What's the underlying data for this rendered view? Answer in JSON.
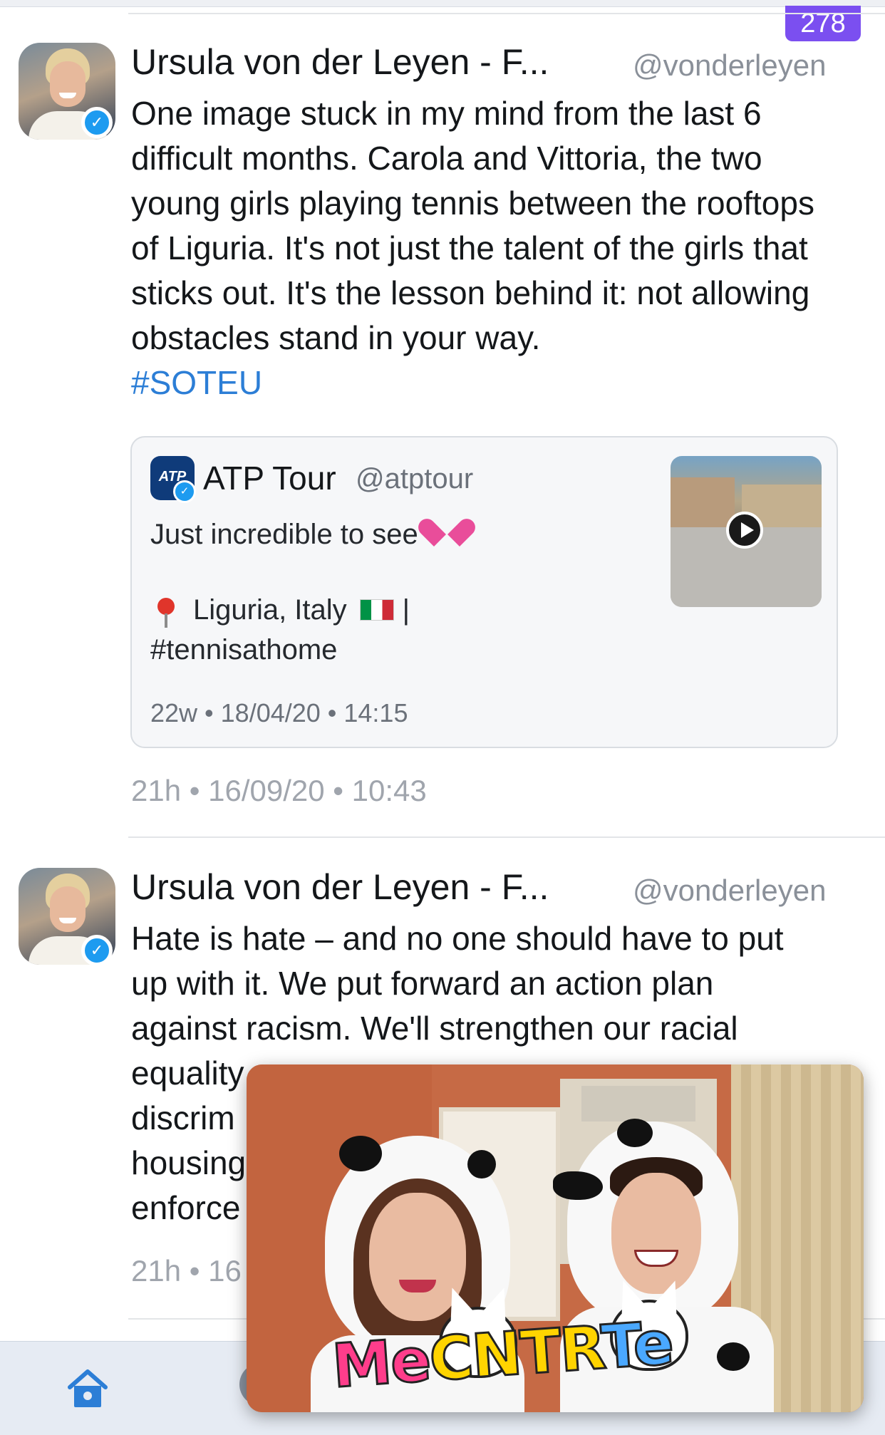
{
  "header": {
    "unread_count": "278"
  },
  "tweets": [
    {
      "author_name": "Ursula von der Leyen - F...",
      "handle": "@vonderleyen",
      "text": "One image stuck in my mind from the last 6 difficult months. Carola and Vittoria, the two young girls playing tennis between the rooftops of Liguria. It's not just the talent of the girls that sticks out. It's the lesson behind it: not allowing obstacles stand in your way.",
      "hashtag": "#SOTEU",
      "meta": "21h • 16/09/20 • 10:43",
      "quote": {
        "author_name": "ATP Tour",
        "handle": "@atptour",
        "logo_text": "ATP",
        "text": "Just incredible to see",
        "location": "Liguria, Italy",
        "separator": "|",
        "hashtag": "#tennisathome",
        "meta": "22w • 18/04/20 • 14:15"
      }
    },
    {
      "author_name": "Ursula von der Leyen - F...",
      "handle": "@vonderleyen",
      "text_line1": "Hate is hate – and no one should have to put",
      "text_line2": "up with it. We put forward an action plan",
      "text_line3": "against racism. We'll strengthen our racial",
      "text_line4": "equality",
      "text_line5": "discrim",
      "text_line6": "housing",
      "text_line7": "enforce",
      "meta": "21h • 16"
    }
  ],
  "video_overlay": {
    "logo_text_1": "Me",
    "logo_text_2": "C",
    "logo_text_3": "NTR",
    "logo_text_4": "Te"
  },
  "tabbar": {
    "home_icon": "home-icon"
  },
  "colors": {
    "accent": "#7b4ff0",
    "link": "#2c7ed6",
    "verified": "#1d9bf0",
    "muted_text": "#a0a5ad",
    "tabbar_bg": "#e6ebf3"
  }
}
